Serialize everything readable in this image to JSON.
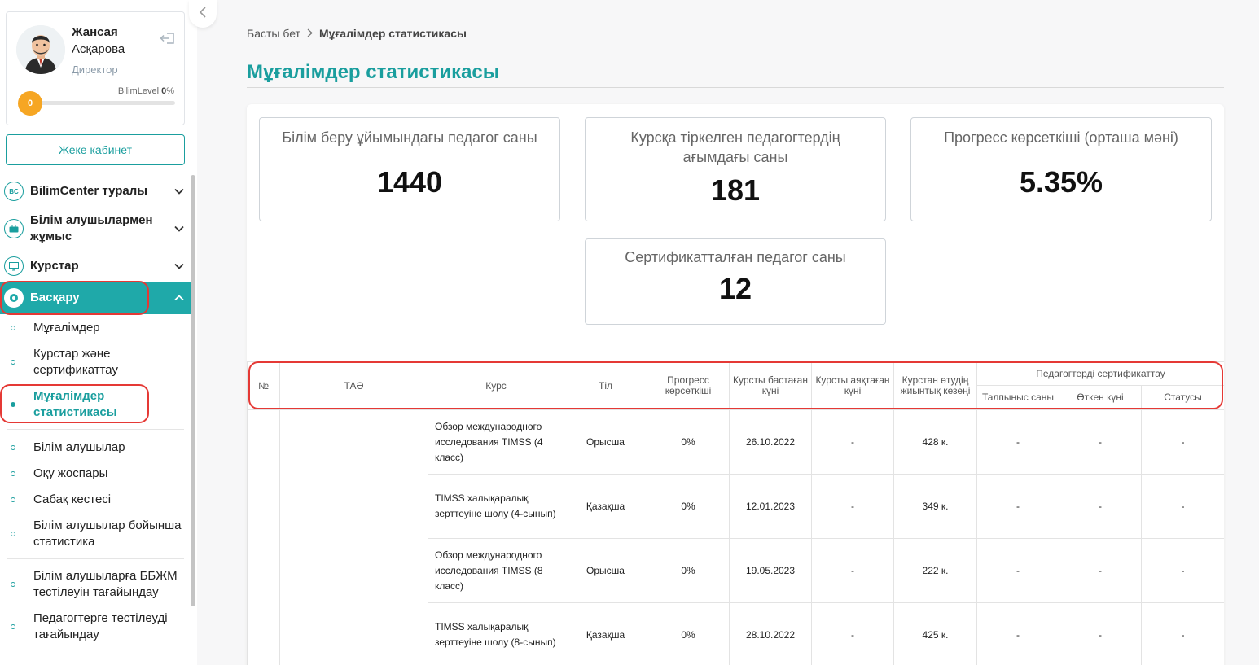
{
  "profile": {
    "first_name": "Жансая",
    "last_name": "Асқарова",
    "role": "Директор",
    "level_label": "BilimLevel",
    "level_percent": "0",
    "level_pct_sign": "%",
    "level_badge": "0",
    "level_progress": 0
  },
  "cabinet_button": "Жеке кабинет",
  "menu": {
    "about": "BilimCenter туралы",
    "about_icon": "BC",
    "students_work": "Білім алушылармен жұмыс",
    "courses": "Курстар",
    "manage": "Басқару"
  },
  "submenu": {
    "teachers": "Мұғалімдер",
    "courses_cert": "Курстар және сертификаттау",
    "teacher_stats": "Мұғалімдер статистикасы",
    "students": "Білім алушылар",
    "curriculum": "Оқу жоспары",
    "schedule": "Сабақ кестесі",
    "student_stats": "Білім алушылар бойынша статистика",
    "assign_bbzhm": "Білім алушыларға ББЖМ тестілеуін тағайындау",
    "assign_teacher_test": "Педагогтерге тестілеуді тағайындау"
  },
  "breadcrumb": {
    "home": "Басты бет",
    "current": "Мұғалімдер статистикасы"
  },
  "page_title": "Мұғалімдер статистикасы",
  "stats": [
    {
      "label": "Білім беру ұйымындағы педагог саны",
      "value": "1440"
    },
    {
      "label": "Курсқа тіркелген педагогтердің ағымдағы саны",
      "value": "181"
    },
    {
      "label": "Прогресс көрсеткіші (орташа мәні)",
      "value": "5.35%"
    },
    {
      "label": "Сертификатталған педагог саны",
      "value": "12"
    }
  ],
  "table": {
    "headers": {
      "num": "№",
      "name": "ТАӘ",
      "course": "Курс",
      "lang": "Тіл",
      "progress": "Прогресс көрсеткіші",
      "start": "Курсты бастаған күні",
      "end": "Курсты аяқтаған күні",
      "period": "Курстан өтудің жиынтық кезеңі",
      "cert_group": "Педагогтерді сертификаттау",
      "attempts": "Талпыныс саны",
      "passed": "Өткен күні",
      "status": "Статусы"
    },
    "rows": [
      {
        "course": "Обзор международного исследования TIMSS (4 класс)",
        "lang": "Орысша",
        "progress": "0%",
        "start": "26.10.2022",
        "end": "-",
        "period": "428 к.",
        "attempts": "-",
        "passed": "-",
        "status": "-"
      },
      {
        "course": "TIMSS халықаралық зерттеуіне шолу (4-сынып)",
        "lang": "Қазақша",
        "progress": "0%",
        "start": "12.01.2023",
        "end": "-",
        "period": "349 к.",
        "attempts": "-",
        "passed": "-",
        "status": "-"
      },
      {
        "course": "Обзор международного исследования TIMSS (8 класс)",
        "lang": "Орысша",
        "progress": "0%",
        "start": "19.05.2023",
        "end": "-",
        "period": "222 к.",
        "attempts": "-",
        "passed": "-",
        "status": "-"
      },
      {
        "course": "TIMSS халықаралық зерттеуіне шолу (8-сынып)",
        "lang": "Қазақша",
        "progress": "0%",
        "start": "28.10.2022",
        "end": "-",
        "period": "425 к.",
        "attempts": "-",
        "passed": "-",
        "status": "-"
      }
    ]
  },
  "colors": {
    "accent": "#1a9e9e",
    "active_menu_bg": "#1fa9a9",
    "highlight": "#e53935",
    "level_badge": "#f6a623"
  }
}
